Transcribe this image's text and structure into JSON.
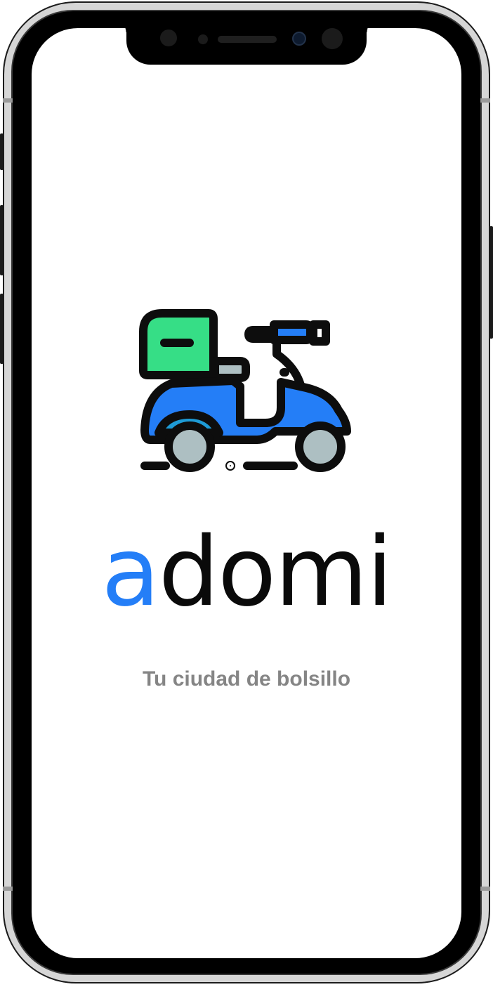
{
  "brand": {
    "accent_letter": "a",
    "rest": "domi",
    "accent_color": "#247ef7",
    "text_color": "#0a0a0a"
  },
  "tagline": "Tu ciudad de bolsillo",
  "tagline_color": "#858585",
  "icon": {
    "name": "delivery-scooter-icon",
    "colors": {
      "body": "#247ef7",
      "wheel_arch": "#1e9bd6",
      "box": "#36de86",
      "wheels": "#adbfc2",
      "outline": "#0d0d0d"
    }
  }
}
